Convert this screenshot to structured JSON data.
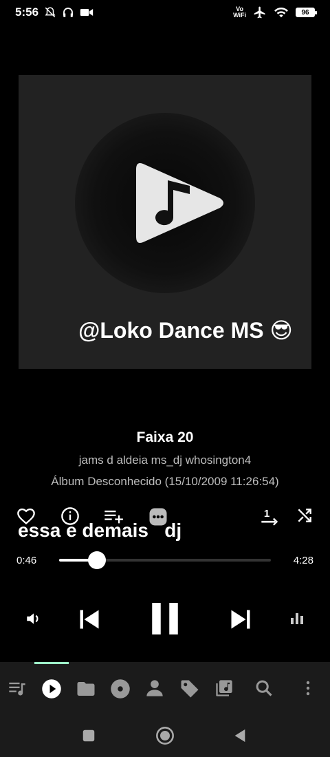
{
  "status_bar": {
    "time": "5:56",
    "vowifi_top": "Vo",
    "vowifi_bottom": "WiFi",
    "battery": "96"
  },
  "album_art": {
    "caption": "@Loko Dance MS 😎"
  },
  "track": {
    "title": "Faixa 20",
    "artist": "jams d aldeia ms_dj whosington4",
    "album": "Álbum Desconhecido (15/10/2009 11:26:54)"
  },
  "lyric_overlay": "essa e demais   dj",
  "progress": {
    "current": "0:46",
    "duration": "4:28",
    "fraction": 0.18
  },
  "colors": {
    "accent": "#9ef0c9",
    "art_bg": "#222222",
    "nav_bg": "#1b1b1b"
  },
  "icons": {
    "actions": [
      "heart-icon",
      "info-icon",
      "playlist-add-icon",
      "more-icon",
      "repeat-one-icon",
      "shuffle-icon"
    ],
    "controls": [
      "volume-icon",
      "previous-icon",
      "pause-icon",
      "next-icon",
      "equalizer-icon"
    ],
    "nav": [
      "queue-icon",
      "now-playing-icon",
      "folder-icon",
      "album-icon",
      "artist-icon",
      "tag-icon",
      "playlist-icon",
      "search-icon",
      "overflow-menu-icon"
    ],
    "system": [
      "recents-button",
      "home-button",
      "back-button"
    ]
  }
}
